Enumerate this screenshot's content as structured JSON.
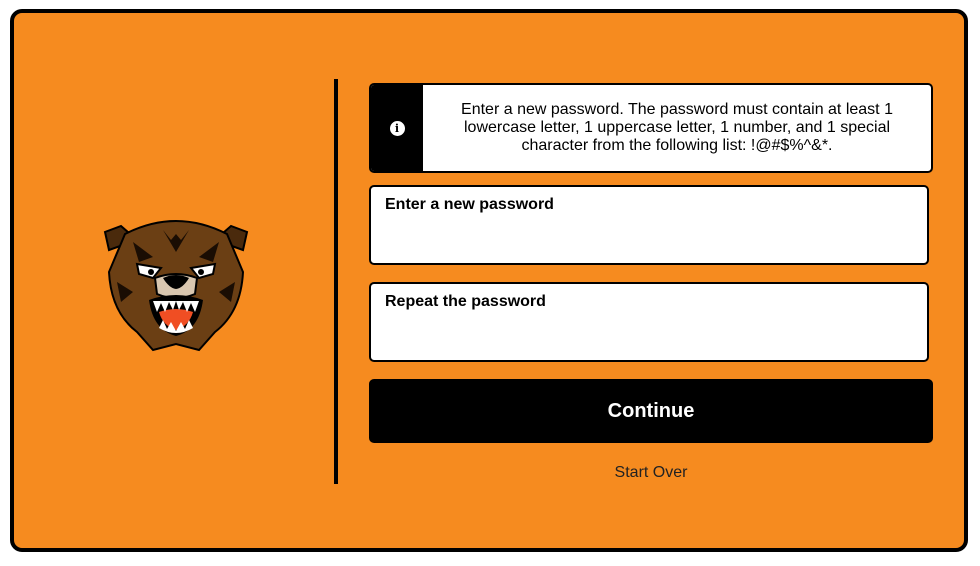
{
  "info": {
    "icon": "info-icon",
    "icon_glyph": "i",
    "message": "Enter a new password. The password must contain at least 1 lowercase letter, 1 uppercase letter, 1 number, and 1 special character from the following list: !@#$%^&*."
  },
  "fields": {
    "new_password": {
      "label": "Enter a new password",
      "value": ""
    },
    "repeat_password": {
      "label": "Repeat the password",
      "value": ""
    }
  },
  "actions": {
    "continue_label": "Continue",
    "start_over_label": "Start Over"
  },
  "colors": {
    "background": "#f68b1f",
    "frame_border": "#000000",
    "button": "#000000",
    "button_text": "#ffffff",
    "logo_fur": "#6b3f14",
    "logo_mouth": "#f04e23"
  },
  "logo": {
    "icon": "bear-mascot-icon"
  }
}
